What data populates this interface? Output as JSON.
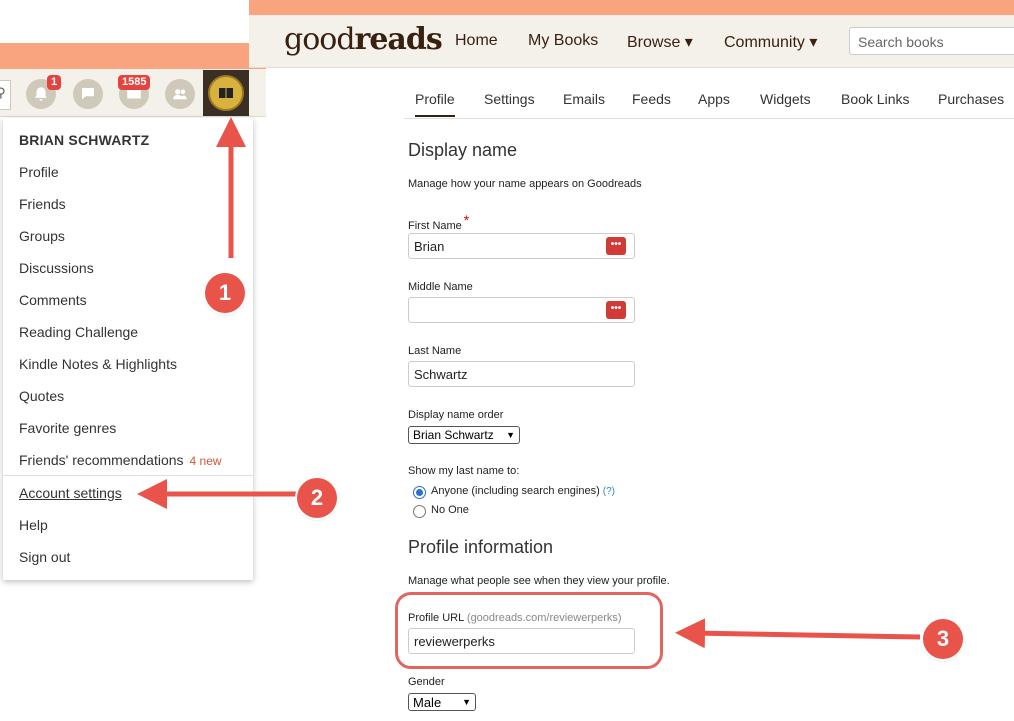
{
  "left_nav": {
    "notifications_badge": "1",
    "messages_badge": "1585"
  },
  "dropdown": {
    "user_name": "BRIAN SCHWARTZ",
    "items": [
      "Profile",
      "Friends",
      "Groups",
      "Discussions",
      "Comments",
      "Reading Challenge",
      "Kindle Notes & Highlights",
      "Quotes",
      "Favorite genres"
    ],
    "friends_recs_label": "Friends' recommendations",
    "friends_recs_new": "4 new",
    "account_settings": "Account settings",
    "help": "Help",
    "sign_out": "Sign out"
  },
  "header": {
    "logo_light": "good",
    "logo_bold": "reads",
    "nav": [
      "Home",
      "My Books",
      "Browse ▾",
      "Community ▾"
    ],
    "search_placeholder": "Search books"
  },
  "tabs": [
    "Profile",
    "Settings",
    "Emails",
    "Feeds",
    "Apps",
    "Widgets",
    "Book Links",
    "Purchases"
  ],
  "display_name": {
    "heading": "Display name",
    "description": "Manage how your name appears on Goodreads",
    "first_name_label": "First Name",
    "first_name_value": "Brian",
    "middle_name_label": "Middle Name",
    "middle_name_value": "",
    "last_name_label": "Last Name",
    "last_name_value": "Schwartz",
    "order_label": "Display name order",
    "order_value": "Brian Schwartz",
    "show_last_label": "Show my last name to:",
    "option_anyone": "Anyone (including search engines)",
    "option_help": "(?)",
    "option_none": "No One"
  },
  "profile_info": {
    "heading": "Profile information",
    "description": "Manage what people see when they view your profile.",
    "url_label": "Profile URL",
    "url_hint": "(goodreads.com/reviewerperks)",
    "url_value": "reviewerperks",
    "gender_label": "Gender",
    "gender_value": "Male"
  },
  "annotations": {
    "step1": "1",
    "step2": "2",
    "step3": "3",
    "color": "#e8534a"
  },
  "colors": {
    "header_bg": "#f4f1ea",
    "accent_orange": "#f9a37f",
    "brand_brown": "#382110"
  }
}
